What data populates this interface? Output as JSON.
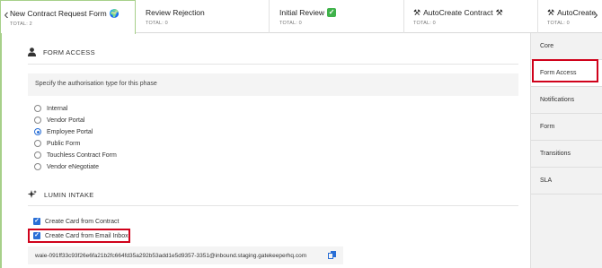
{
  "tabs": [
    {
      "title": "New Contract Request Form",
      "icon": "globe-icon",
      "total": "TOTAL: 2"
    },
    {
      "title": "Review Rejection",
      "total": "TOTAL: 0"
    },
    {
      "title": "Initial Review",
      "icon": "check-mark-icon",
      "total": "TOTAL: 0"
    },
    {
      "title": "AutoCreate Contract",
      "icon": "hammer-pick-icon",
      "total": "TOTAL: 0"
    },
    {
      "title": "AutoCreate",
      "icon": "hammer-pick-icon",
      "total": "TOTAL: 0"
    }
  ],
  "form_access": {
    "heading": "FORM ACCESS",
    "instruction": "Specify the authorisation type for this phase",
    "options": [
      "Internal",
      "Vendor Portal",
      "Employee Portal",
      "Public Form",
      "Touchless Contract Form",
      "Vendor eNegotiate"
    ],
    "selected": "Employee Portal"
  },
  "lumin_intake": {
    "heading": "LUMIN INTAKE",
    "checkboxes": [
      {
        "label": "Create Card from Contract",
        "checked": true
      },
      {
        "label": "Create Card from Email Inbox",
        "checked": true
      }
    ],
    "email": "waie-091ff33c93f26e6fa21b2fc664fd35a292b53add1e5d9357-3351@inbound.staging.gatekeeperhq.com"
  },
  "sidebar": {
    "items": [
      "Core",
      "Form Access",
      "Notifications",
      "Form",
      "Transitions",
      "SLA"
    ],
    "active": "Form Access"
  },
  "colors": {
    "accent": "#2a6fd6",
    "highlight": "#d0021b",
    "active_tab_border": "#a7d08a"
  }
}
